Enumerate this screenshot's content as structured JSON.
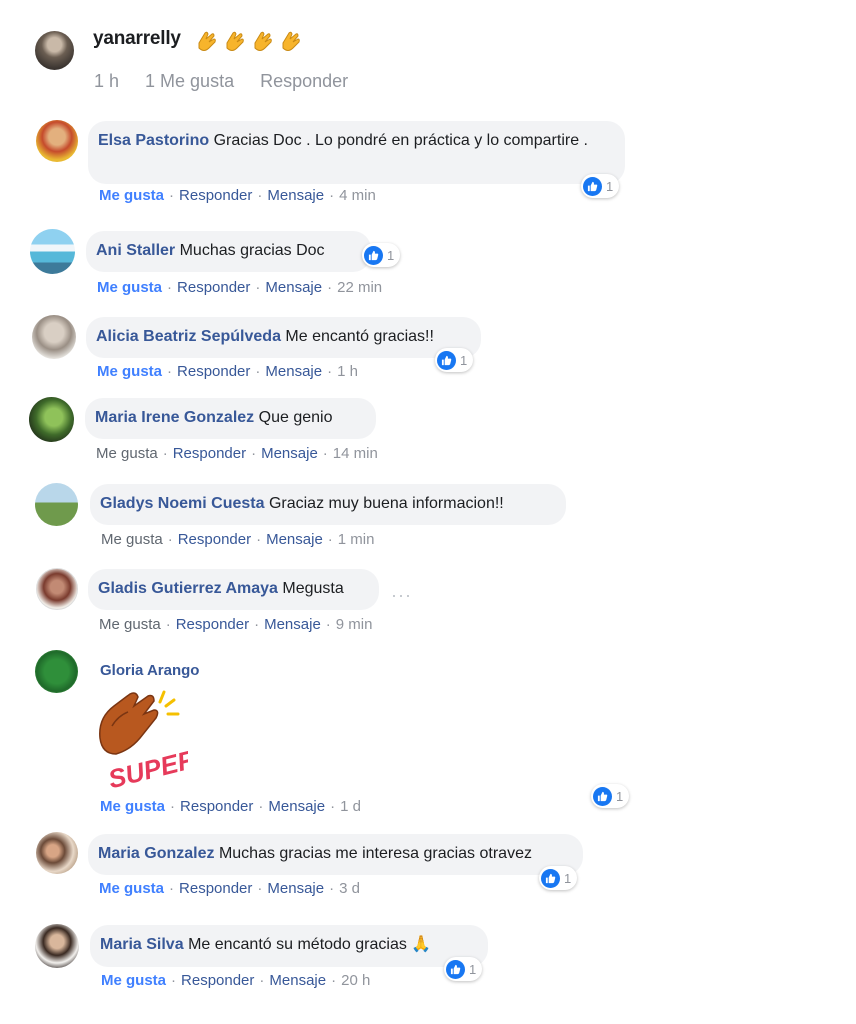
{
  "top_comment": {
    "author": "yanarrelly",
    "time": "1 h",
    "likes": "1 Me gusta",
    "reply": "Responder"
  },
  "comments": [
    {
      "author": "Elsa Pastorino",
      "text": "Gracias Doc . Lo pondré en práctica y lo compartire .",
      "like": "Me gusta",
      "reply": "Responder",
      "message": "Mensaje",
      "time": "4 min",
      "reactions": "1"
    },
    {
      "author": "Ani Staller",
      "text": "Muchas gracias Doc",
      "like": "Me gusta",
      "reply": "Responder",
      "message": "Mensaje",
      "time": "22 min",
      "reactions": "1"
    },
    {
      "author": "Alicia Beatriz Sepúlveda",
      "text": "Me encantó gracias!!",
      "like": "Me gusta",
      "reply": "Responder",
      "message": "Mensaje",
      "time": "1 h",
      "reactions": "1"
    },
    {
      "author": "Maria Irene Gonzalez",
      "text": "Que genio",
      "like": "Me gusta",
      "reply": "Responder",
      "message": "Mensaje",
      "time": "14 min"
    },
    {
      "author": "Gladys Noemi Cuesta",
      "text": "Graciaz muy buena informacion!!",
      "like": "Me gusta",
      "reply": "Responder",
      "message": "Mensaje",
      "time": "1 min"
    },
    {
      "author": "Gladis Gutierrez Amaya",
      "text": "Megusta",
      "like": "Me gusta",
      "reply": "Responder",
      "message": "Mensaje",
      "time": "9 min"
    },
    {
      "author": "Gloria Arango",
      "sticker_text": "SUPER!",
      "like": "Me gusta",
      "reply": "Responder",
      "message": "Mensaje",
      "time": "1 d",
      "reactions": "1"
    },
    {
      "author": "Maria Gonzalez",
      "text": "Muchas gracias me interesa gracias otravez",
      "like": "Me gusta",
      "reply": "Responder",
      "message": "Mensaje",
      "time": "3 d",
      "reactions": "1"
    },
    {
      "author": "Maria Silva",
      "text": "Me encantó su método gracias 🙏",
      "like": "Me gusta",
      "reply": "Responder",
      "message": "Mensaje",
      "time": "20 h",
      "reactions": "1"
    }
  ],
  "more_options": "···"
}
